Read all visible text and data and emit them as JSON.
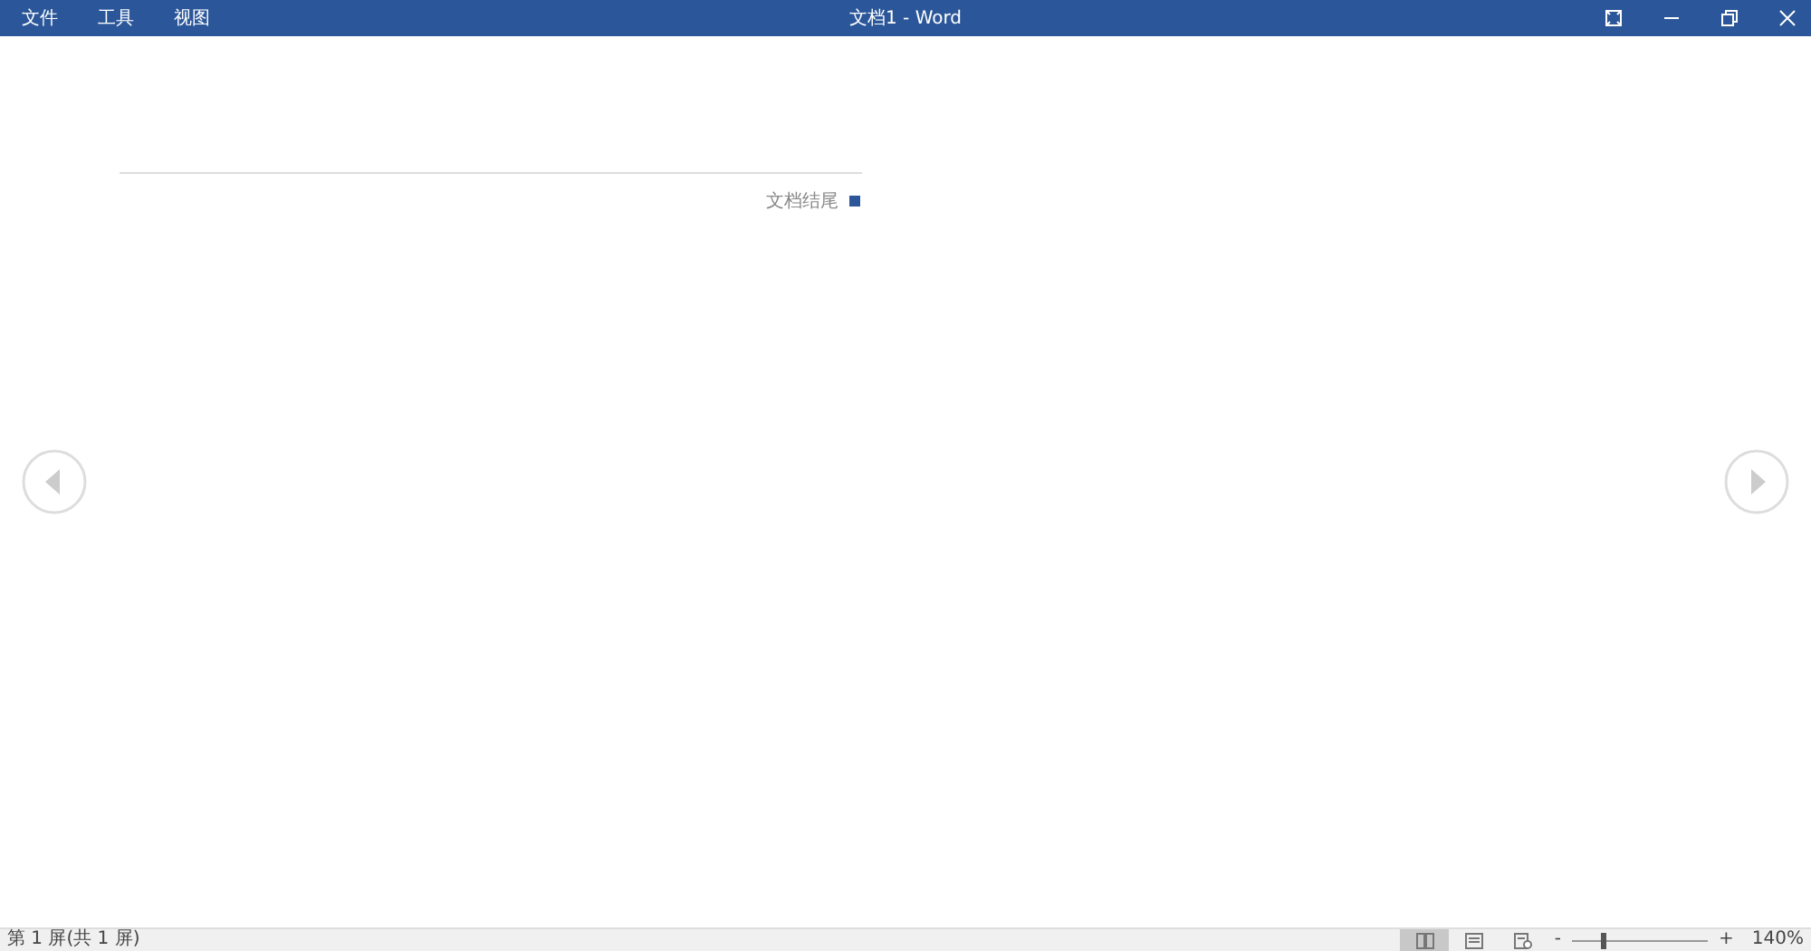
{
  "window": {
    "title": "文档1  -  Word"
  },
  "menu": [
    {
      "label": "文件"
    },
    {
      "label": "工具"
    },
    {
      "label": "视图"
    }
  ],
  "document": {
    "end_marker": "文档结尾"
  },
  "status_bar": {
    "page": "第 1 屏(共 1 屏)",
    "views": [
      {
        "kind": "read",
        "selected": true
      },
      {
        "kind": "print",
        "selected": false
      },
      {
        "kind": "web",
        "selected": false
      }
    ],
    "zoom_out": "-",
    "zoom_in": "+",
    "zoom": {
      "level": 0.22
    },
    "zoom_reading": "140%"
  }
}
